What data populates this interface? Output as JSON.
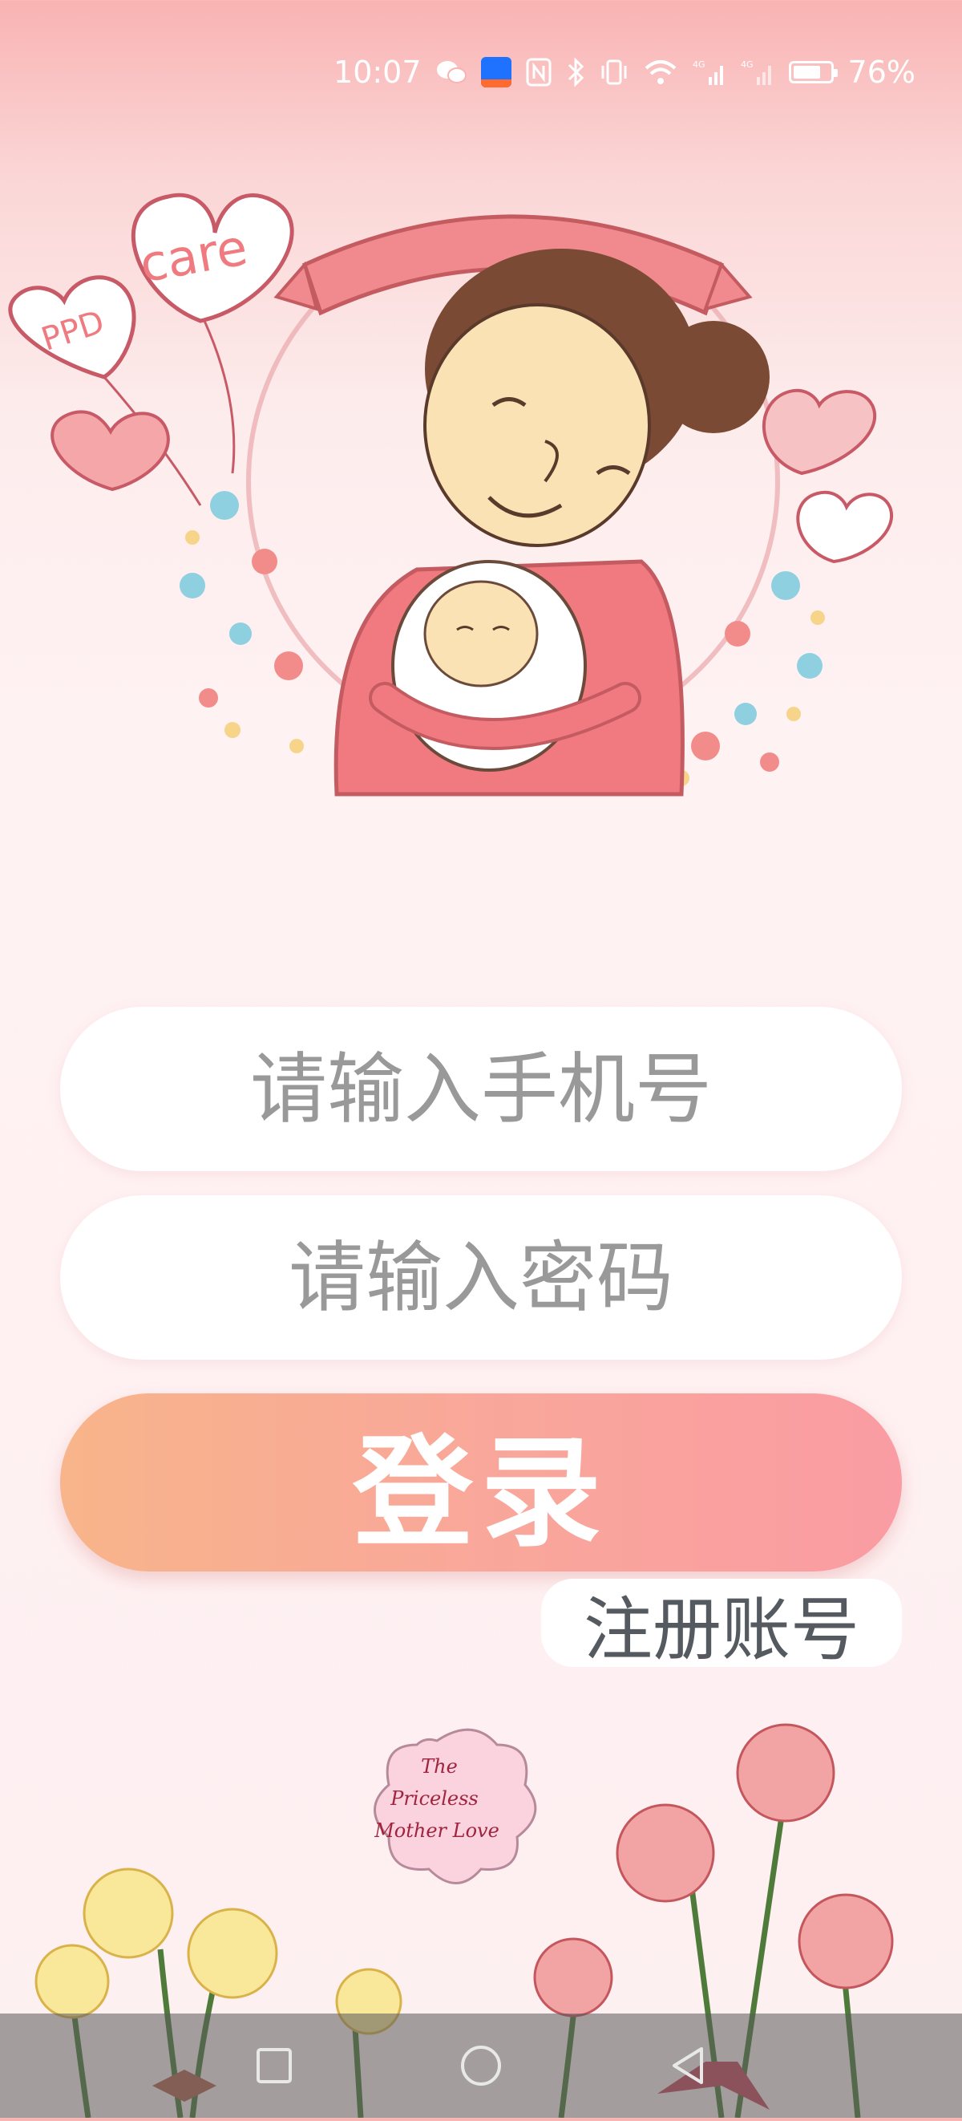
{
  "status_bar": {
    "time": "10:07",
    "battery_percent": "76%",
    "battery_level": 0.76,
    "icons": [
      "wechat-icon",
      "app-notification-icon",
      "nfc-icon",
      "bluetooth-icon",
      "vibrate-icon",
      "wifi-icon",
      "signal-4g-icon",
      "signal-4g-icon",
      "battery-icon"
    ]
  },
  "hero": {
    "heart_labels": [
      "care",
      "PPD"
    ]
  },
  "login_form": {
    "phone_placeholder": "请输入手机号",
    "password_placeholder": "请输入密码",
    "login_label": "登录",
    "register_label": "注册账号"
  },
  "decor": {
    "badge_lines": [
      "The",
      "Priceless",
      "Mother Love"
    ]
  },
  "nav_bar": {
    "buttons": [
      "recents-icon",
      "home-icon",
      "back-icon"
    ]
  }
}
